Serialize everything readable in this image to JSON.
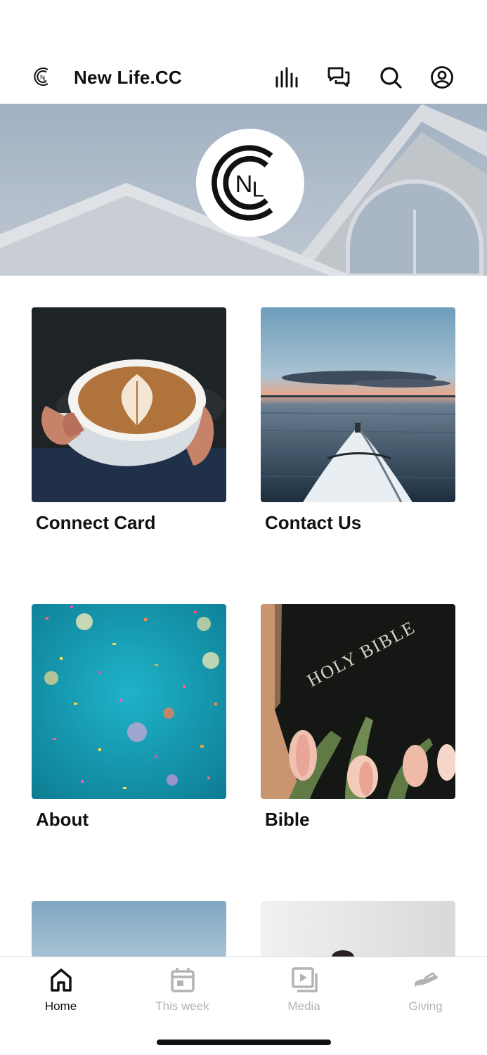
{
  "header": {
    "title": "New Life.CC",
    "icons": [
      "church-logo-icon",
      "audio-bars-icon",
      "chat-icon",
      "search-icon",
      "profile-icon"
    ]
  },
  "hero": {
    "logo_letters": "NL"
  },
  "tiles": [
    {
      "label": "Connect Card",
      "image": "latte-cup-photo"
    },
    {
      "label": "Contact Us",
      "image": "kayak-on-lake-photo"
    },
    {
      "label": "About",
      "image": "confetti-on-teal-photo"
    },
    {
      "label": "Bible",
      "image": "holy-bible-with-tulips-photo",
      "image_text": "HOLY BIBLE"
    },
    {
      "label": "",
      "image": "sky-photo"
    },
    {
      "label": "",
      "image": "light-sky-photo"
    }
  ],
  "bottom_nav": {
    "items": [
      {
        "label": "Home",
        "icon": "home-icon",
        "active": true
      },
      {
        "label": "This week",
        "icon": "calendar-icon",
        "active": false
      },
      {
        "label": "Media",
        "icon": "media-icon",
        "active": false
      },
      {
        "label": "Giving",
        "icon": "giving-hand-icon",
        "active": false
      }
    ]
  },
  "colors": {
    "active": "#111111",
    "inactive": "#b3b3b3",
    "hero_tint": "#b9c4cf"
  }
}
